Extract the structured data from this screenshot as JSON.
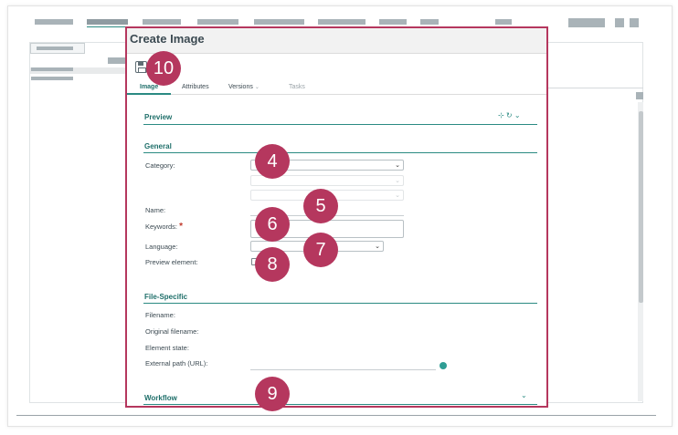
{
  "dialog": {
    "title": "Create Image",
    "tabs": [
      {
        "label": "Image"
      },
      {
        "label": "Attributes"
      },
      {
        "label": "Versions",
        "chevron": "⌄"
      },
      {
        "label": "Tasks"
      }
    ],
    "sections": {
      "preview": {
        "title": "Preview",
        "tools": "⊹ ↻ ⌄"
      },
      "general": {
        "title": "General"
      },
      "file_specific": {
        "title": "File-Specific"
      },
      "workflow": {
        "title": "Workflow",
        "chevron": "⌄"
      }
    },
    "fields": {
      "category": "Category:",
      "name": "Name:",
      "keywords": "Keywords:",
      "required_mark": "*",
      "language": "Language:",
      "preview_element": "Preview element:",
      "filename": "Filename:",
      "original_filename": "Original filename:",
      "element_state": "Element state:",
      "external_path": "External path (URL):"
    },
    "select_arrow": "⌄"
  },
  "callouts": [
    "10",
    "4",
    "5",
    "6",
    "7",
    "8",
    "9"
  ],
  "colors": {
    "callout": "#b5375e",
    "accent": "#2a8a82",
    "section_text": "#1f6f6a"
  },
  "icons": {
    "save": "save-icon",
    "status": "check-status-icon"
  }
}
